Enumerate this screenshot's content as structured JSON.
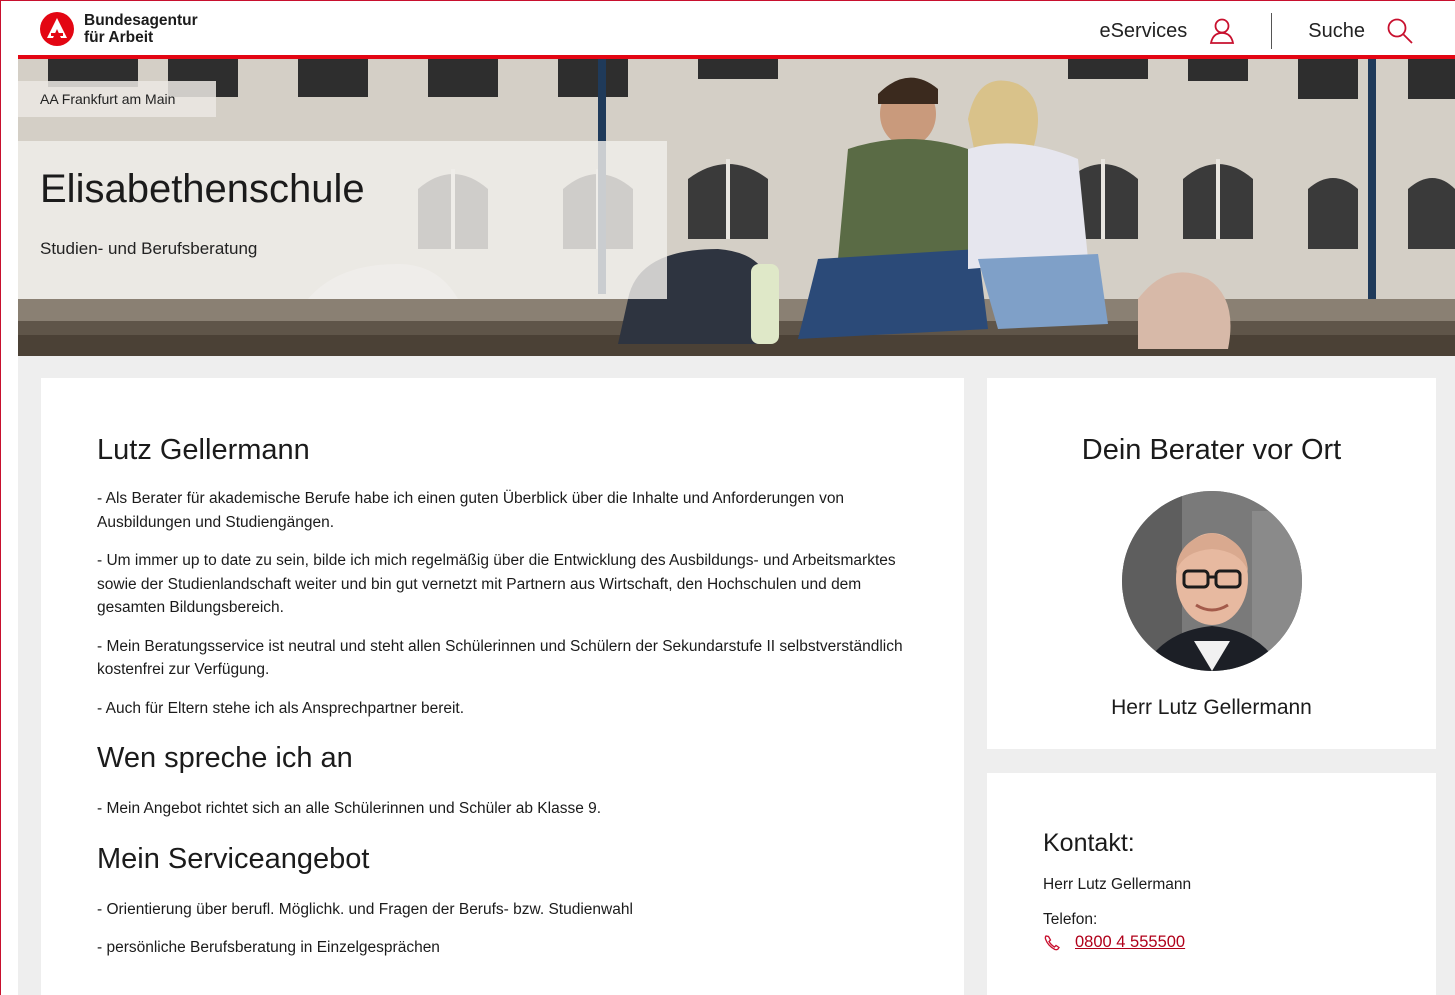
{
  "brand": {
    "line1": "Bundesagentur",
    "line2": "für Arbeit",
    "color": "#e30613"
  },
  "header": {
    "eservices_label": "eServices",
    "search_label": "Suche"
  },
  "hero": {
    "breadcrumb": "AA Frankfurt am Main",
    "title": "Elisabethenschule",
    "subtitle": "Studien- und Berufsberatung"
  },
  "main": {
    "sections": [
      {
        "heading": "Lutz Gellermann",
        "paragraphs": [
          "- Als Berater für akademische Berufe habe ich einen guten Überblick über die Inhalte und Anforderungen von Ausbildungen und Studiengängen.",
          "- Um immer up to date zu sein, bilde ich mich regelmäßig über die Entwicklung des Ausbildungs- und Arbeitsmarktes sowie der Studienlandschaft weiter und bin gut vernetzt mit Partnern aus Wirtschaft, den Hochschulen und dem gesamten Bildungsbereich.",
          "- Mein Beratungsservice ist neutral und steht allen Schülerinnen und Schülern der Sekundarstufe II selbstverständlich kostenfrei zur Verfügung.",
          "- Auch für Eltern stehe ich als Ansprechpartner bereit."
        ]
      },
      {
        "heading": "Wen spreche ich an",
        "paragraphs": [
          "- Mein Angebot richtet sich an alle Schülerinnen und Schüler ab Klasse 9."
        ]
      },
      {
        "heading": "Mein Serviceangebot",
        "paragraphs": [
          "- Orientierung über berufl. Möglichk. und Fragen der Berufs- bzw. Studienwahl",
          "- persönliche Berufsberatung in Einzelgesprächen"
        ]
      }
    ]
  },
  "advisor_card": {
    "title": "Dein Berater vor Ort",
    "name": "Herr Lutz Gellermann"
  },
  "contact_card": {
    "title": "Kontakt:",
    "name": "Herr Lutz Gellermann",
    "phone_label": "Telefon:",
    "phone_number": "0800 4 555500"
  },
  "icons": {
    "eservices": "user-icon",
    "search": "search-icon",
    "phone": "phone-icon",
    "logo": "ba-logo-icon"
  }
}
